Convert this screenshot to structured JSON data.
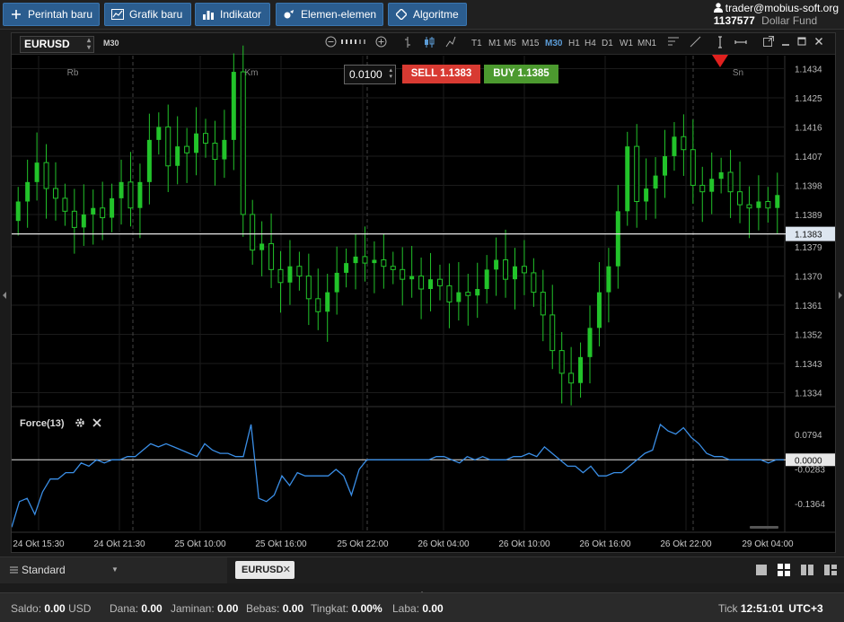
{
  "toolbar": {
    "buttons": [
      {
        "label": "Perintah baru",
        "icon": "plus-icon"
      },
      {
        "label": "Grafik baru",
        "icon": "chart-icon"
      },
      {
        "label": "Indikator",
        "icon": "bars-icon"
      },
      {
        "label": "Elemen-elemen",
        "icon": "elements-icon"
      },
      {
        "label": "Algoritme",
        "icon": "algorithm-icon"
      }
    ],
    "account_email": "trader@mobius-soft.org",
    "account_id": "1137577",
    "account_type": "Dollar Fund"
  },
  "chart": {
    "symbol": "EURUSD",
    "timeframe": "M30",
    "timeframes": [
      "T1",
      "M1",
      "M5",
      "M15",
      "M30",
      "H1",
      "H4",
      "D1",
      "W1",
      "MN1"
    ],
    "active_timeframe": "M30",
    "lot_value": "0.0100",
    "sell_label": "SELL 1.1383",
    "buy_label": "BUY 1.1385",
    "current_price_label": "1.1383",
    "day_labels": [
      "Rb",
      "Km",
      "Sn"
    ],
    "colors": {
      "up": "#22c32a",
      "price_line": "#e6e6e6",
      "indicator": "#3a8ee6",
      "sell": "#d83a32",
      "buy": "#4c9a2f",
      "marker": "#e0201e"
    }
  },
  "chart_data": [
    {
      "type": "candlestick",
      "title": "",
      "symbol": "EURUSD",
      "timeframe": "M30",
      "y_ticks": [
        "1.1434",
        "1.1425",
        "1.1416",
        "1.1407",
        "1.1398",
        "1.1389",
        "1.1379",
        "1.1370",
        "1.1361",
        "1.1352",
        "1.1343",
        "1.1334"
      ],
      "ylim": [
        1.133,
        1.1438
      ],
      "x_ticks": [
        "24 Okt 15:30",
        "24 Okt 21:30",
        "25 Okt 10:00",
        "25 Okt 16:00",
        "25 Okt 22:00",
        "26 Okt 04:00",
        "26 Okt 10:00",
        "26 Okt 16:00",
        "26 Okt 22:00",
        "29 Okt 04:00"
      ],
      "current_price": 1.1383,
      "close": [
        1.1393,
        1.1399,
        1.1405,
        1.1397,
        1.1394,
        1.139,
        1.1385,
        1.1389,
        1.1391,
        1.1388,
        1.1394,
        1.1399,
        1.1391,
        1.1399,
        1.1412,
        1.1416,
        1.1404,
        1.141,
        1.1408,
        1.1414,
        1.1411,
        1.1406,
        1.1412,
        1.1433,
        1.1389,
        1.1378,
        1.138,
        1.1372,
        1.1368,
        1.1373,
        1.137,
        1.1363,
        1.1359,
        1.1365,
        1.1371,
        1.1374,
        1.1376,
        1.1374,
        1.1375,
        1.1373,
        1.1372,
        1.1369,
        1.137,
        1.1366,
        1.1369,
        1.1367,
        1.1362,
        1.1365,
        1.1364,
        1.1366,
        1.1372,
        1.1375,
        1.1369,
        1.1373,
        1.1371,
        1.1365,
        1.1358,
        1.1347,
        1.134,
        1.1337,
        1.1345,
        1.1354,
        1.1365,
        1.1373,
        1.139,
        1.141,
        1.1393,
        1.1397,
        1.1401,
        1.1407,
        1.1413,
        1.1409,
        1.1398,
        1.1396,
        1.14,
        1.1402,
        1.1396,
        1.1392,
        1.1391,
        1.1393,
        1.1391,
        1.1395
      ]
    },
    {
      "type": "line",
      "title": "Force(13)",
      "y_ticks": [
        "0.0794",
        "0.0000",
        "-0.0283",
        "-0.1364"
      ],
      "current_value_label": "0.0000",
      "ylim": [
        -0.22,
        0.16
      ],
      "series": [
        {
          "values": [
            -0.21,
            -0.13,
            -0.12,
            -0.17,
            -0.1,
            -0.06,
            -0.06,
            -0.04,
            -0.04,
            -0.01,
            -0.02,
            0.0,
            -0.01,
            0.0,
            0.0,
            0.01,
            0.01,
            0.03,
            0.05,
            0.04,
            0.05,
            0.04,
            0.03,
            0.02,
            0.01,
            0.05,
            0.03,
            0.02,
            0.02,
            0.01,
            0.01,
            0.11,
            -0.12,
            -0.13,
            -0.11,
            -0.05,
            -0.08,
            -0.04,
            -0.05,
            -0.05,
            -0.05,
            -0.05,
            -0.03,
            -0.05,
            -0.11,
            -0.03,
            0.0,
            0.0,
            0.0,
            0.0,
            0.0,
            0.0,
            0.0,
            0.0,
            0.0,
            0.01,
            0.01,
            0.0,
            -0.01,
            0.01,
            0.0,
            0.01,
            0.0,
            0.0,
            0.0,
            0.01,
            0.01,
            0.02,
            0.01,
            0.04,
            0.02,
            0.0,
            -0.02,
            -0.02,
            -0.04,
            -0.02,
            -0.05,
            -0.05,
            -0.04,
            -0.04,
            -0.02,
            0.0,
            0.02,
            0.03,
            0.11,
            0.09,
            0.08,
            0.1,
            0.07,
            0.05,
            0.02,
            0.01,
            0.01,
            0.0,
            0.0,
            0.0,
            0.0,
            0.0,
            -0.01,
            0.0,
            0.0
          ]
        }
      ]
    }
  ],
  "tabs": {
    "workspace": "Standard",
    "chart_tab": "EURUSD"
  },
  "status": {
    "saldo_label": "Saldo:",
    "saldo_value": "0.00",
    "saldo_currency": "USD",
    "dana_label": "Dana:",
    "dana_value": "0.00",
    "jaminan_label": "Jaminan:",
    "jaminan_value": "0.00",
    "bebas_label": "Bebas:",
    "bebas_value": "0.00",
    "tingkat_label": "Tingkat:",
    "tingkat_value": "0.00%",
    "laba_label": "Laba:",
    "laba_value": "0.00",
    "tick_label": "Tick",
    "time": "12:51:01",
    "timezone": "UTC+3"
  }
}
